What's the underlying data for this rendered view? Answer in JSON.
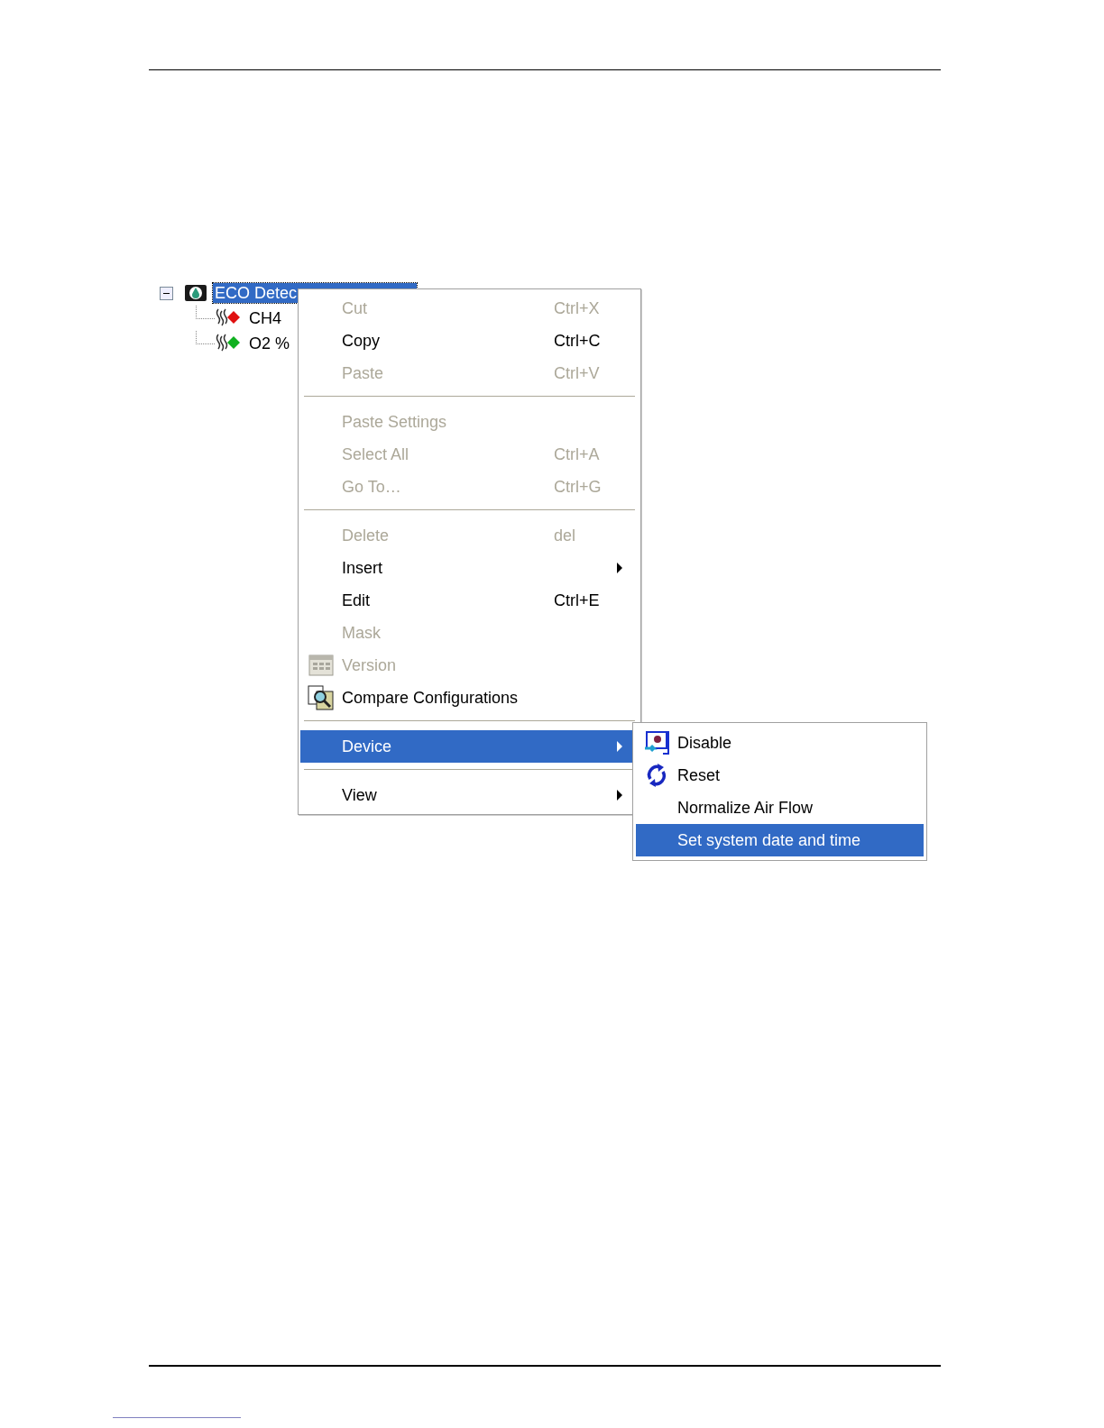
{
  "tree": {
    "label": "ECO Detec",
    "selected": true,
    "expanded": true,
    "children": [
      {
        "label": "CH4",
        "color": "#e01010"
      },
      {
        "label": "O2 %",
        "color": "#10b020"
      }
    ]
  },
  "context_menu": {
    "items": [
      {
        "kind": "item",
        "label": "Cut",
        "shortcut": "Ctrl+X",
        "disabled": true,
        "selected": false,
        "submenu": false
      },
      {
        "kind": "item",
        "label": "Copy",
        "shortcut": "Ctrl+C",
        "disabled": false,
        "selected": false,
        "submenu": false
      },
      {
        "kind": "item",
        "label": "Paste",
        "shortcut": "Ctrl+V",
        "disabled": true,
        "selected": false,
        "submenu": false
      },
      {
        "kind": "separator"
      },
      {
        "kind": "item",
        "label": "Paste Settings",
        "disabled": true,
        "selected": false,
        "submenu": false
      },
      {
        "kind": "item",
        "label": "Select All",
        "shortcut": "Ctrl+A",
        "disabled": true,
        "selected": false,
        "submenu": false
      },
      {
        "kind": "item",
        "label": "Go To…",
        "shortcut": "Ctrl+G",
        "disabled": true,
        "selected": false,
        "submenu": false
      },
      {
        "kind": "separator"
      },
      {
        "kind": "item",
        "label": "Delete",
        "shortcut": "del",
        "disabled": true,
        "selected": false,
        "submenu": false
      },
      {
        "kind": "item",
        "label": "Insert",
        "disabled": false,
        "selected": false,
        "submenu": true
      },
      {
        "kind": "item",
        "label": "Edit",
        "shortcut": "Ctrl+E",
        "disabled": false,
        "selected": false,
        "submenu": false
      },
      {
        "kind": "item",
        "label": "Mask",
        "disabled": true,
        "selected": false,
        "submenu": false
      },
      {
        "kind": "item",
        "label": "Version",
        "disabled": true,
        "selected": false,
        "submenu": false
      },
      {
        "kind": "item",
        "label": "Compare Configurations",
        "disabled": false,
        "selected": false,
        "submenu": false
      },
      {
        "kind": "separator"
      },
      {
        "kind": "item",
        "label": "Device",
        "disabled": false,
        "selected": true,
        "submenu": true
      },
      {
        "kind": "separator"
      },
      {
        "kind": "item",
        "label": "View",
        "disabled": false,
        "selected": false,
        "submenu": true
      }
    ]
  },
  "submenu": {
    "items": [
      {
        "label": "Disable",
        "selected": false
      },
      {
        "label": "Reset",
        "selected": false
      },
      {
        "label": "Normalize Air Flow",
        "selected": false
      },
      {
        "label": "Set system date and time",
        "selected": true
      }
    ]
  }
}
